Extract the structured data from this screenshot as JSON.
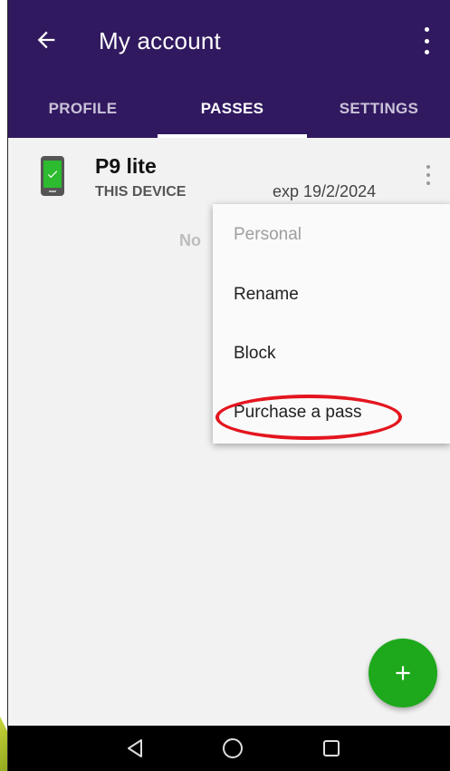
{
  "header": {
    "title": "My account",
    "back_icon": "arrow-left",
    "menu_icon": "more-vertical"
  },
  "tabs": [
    {
      "label": "PROFILE",
      "active": false
    },
    {
      "label": "PASSES",
      "active": true
    },
    {
      "label": "SETTINGS",
      "active": false
    }
  ],
  "device": {
    "name": "P9 lite",
    "subtitle": "THIS DEVICE",
    "expiry": "exp 19/2/2024",
    "icon": "phone-check",
    "status_color": "#2dbb30"
  },
  "background_text": "No",
  "popup_menu": {
    "items": [
      {
        "label": "Personal",
        "enabled": false
      },
      {
        "label": "Rename",
        "enabled": true
      },
      {
        "label": "Block",
        "enabled": true
      },
      {
        "label": "Purchase a pass",
        "enabled": true,
        "highlighted": true
      }
    ]
  },
  "fab": {
    "icon": "plus",
    "color": "#1ea81c"
  },
  "nav_bar": {
    "icons": [
      "back-triangle",
      "home-circle",
      "recent-square"
    ]
  },
  "colors": {
    "app_bar": "#31195f",
    "highlight": "#e4151e"
  }
}
